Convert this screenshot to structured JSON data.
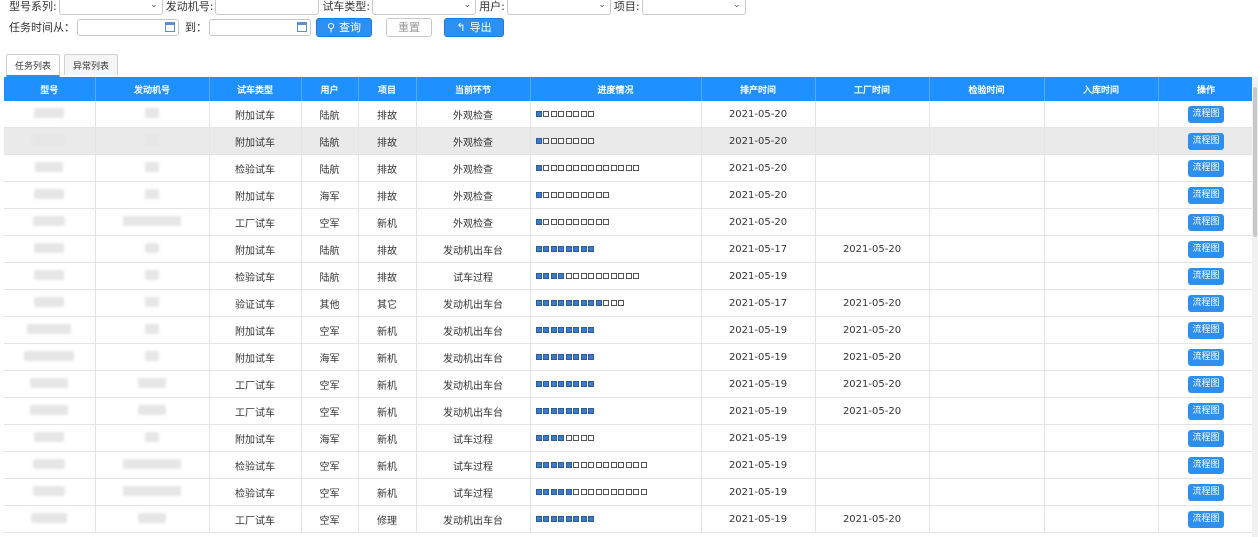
{
  "filters": {
    "model_series_label": "型号系列:",
    "engine_no_label": "发动机号:",
    "test_type_label": "试车类型:",
    "user_label": "用户:",
    "project_label": "项目:",
    "time_from_label": "任务时间从：",
    "time_to_label": "到：",
    "search_button": "查询",
    "reset_button": "重置",
    "export_button": "导出"
  },
  "tabs": [
    {
      "label": "任务列表",
      "active": true
    },
    {
      "label": "异常列表",
      "active": false
    }
  ],
  "table": {
    "columns": [
      "型号",
      "发动机号",
      "试车类型",
      "用户",
      "项目",
      "当前环节",
      "进度情况",
      "排产时间",
      "工厂时间",
      "检验时间",
      "入库时间",
      "操作"
    ],
    "action_label": "流程图",
    "rows": [
      {
        "type": "附加试车",
        "user": "陆航",
        "project": "排故",
        "stage": "外观检查",
        "progress_done": 1,
        "progress_total": 8,
        "sched": "2021-05-20",
        "factory": "",
        "inspect": "",
        "store": ""
      },
      {
        "type": "附加试车",
        "user": "陆航",
        "project": "排故",
        "stage": "外观检查",
        "progress_done": 1,
        "progress_total": 8,
        "sched": "2021-05-20",
        "factory": "",
        "inspect": "",
        "store": ""
      },
      {
        "type": "检验试车",
        "user": "陆航",
        "project": "排故",
        "stage": "外观检查",
        "progress_done": 1,
        "progress_total": 14,
        "sched": "2021-05-20",
        "factory": "",
        "inspect": "",
        "store": ""
      },
      {
        "type": "附加试车",
        "user": "海军",
        "project": "排故",
        "stage": "外观检查",
        "progress_done": 1,
        "progress_total": 10,
        "sched": "2021-05-20",
        "factory": "",
        "inspect": "",
        "store": ""
      },
      {
        "type": "工厂试车",
        "user": "空军",
        "project": "新机",
        "stage": "外观检查",
        "progress_done": 1,
        "progress_total": 10,
        "sched": "2021-05-20",
        "factory": "",
        "inspect": "",
        "store": ""
      },
      {
        "type": "附加试车",
        "user": "陆航",
        "project": "排故",
        "stage": "发动机出车台",
        "progress_done": 8,
        "progress_total": 8,
        "sched": "2021-05-17",
        "factory": "2021-05-20",
        "inspect": "",
        "store": ""
      },
      {
        "type": "检验试车",
        "user": "陆航",
        "project": "排故",
        "stage": "试车过程",
        "progress_done": 4,
        "progress_total": 14,
        "sched": "2021-05-19",
        "factory": "",
        "inspect": "",
        "store": ""
      },
      {
        "type": "验证试车",
        "user": "其他",
        "project": "其它",
        "stage": "发动机出车台",
        "progress_done": 9,
        "progress_total": 12,
        "sched": "2021-05-17",
        "factory": "2021-05-20",
        "inspect": "",
        "store": ""
      },
      {
        "type": "附加试车",
        "user": "空军",
        "project": "新机",
        "stage": "发动机出车台",
        "progress_done": 8,
        "progress_total": 8,
        "sched": "2021-05-19",
        "factory": "2021-05-20",
        "inspect": "",
        "store": ""
      },
      {
        "type": "附加试车",
        "user": "海军",
        "project": "新机",
        "stage": "发动机出车台",
        "progress_done": 8,
        "progress_total": 8,
        "sched": "2021-05-19",
        "factory": "2021-05-20",
        "inspect": "",
        "store": ""
      },
      {
        "type": "工厂试车",
        "user": "空军",
        "project": "新机",
        "stage": "发动机出车台",
        "progress_done": 8,
        "progress_total": 8,
        "sched": "2021-05-19",
        "factory": "2021-05-20",
        "inspect": "",
        "store": ""
      },
      {
        "type": "工厂试车",
        "user": "空军",
        "project": "新机",
        "stage": "发动机出车台",
        "progress_done": 8,
        "progress_total": 8,
        "sched": "2021-05-19",
        "factory": "2021-05-20",
        "inspect": "",
        "store": ""
      },
      {
        "type": "附加试车",
        "user": "海军",
        "project": "新机",
        "stage": "试车过程",
        "progress_done": 4,
        "progress_total": 8,
        "sched": "2021-05-19",
        "factory": "",
        "inspect": "",
        "store": ""
      },
      {
        "type": "检验试车",
        "user": "空军",
        "project": "新机",
        "stage": "试车过程",
        "progress_done": 5,
        "progress_total": 15,
        "sched": "2021-05-19",
        "factory": "",
        "inspect": "",
        "store": ""
      },
      {
        "type": "检验试车",
        "user": "空军",
        "project": "新机",
        "stage": "试车过程",
        "progress_done": 5,
        "progress_total": 15,
        "sched": "2021-05-19",
        "factory": "",
        "inspect": "",
        "store": ""
      },
      {
        "type": "工厂试车",
        "user": "空军",
        "project": "修理",
        "stage": "发动机出车台",
        "progress_done": 8,
        "progress_total": 8,
        "sched": "2021-05-19",
        "factory": "2021-05-20",
        "inspect": "",
        "store": ""
      }
    ]
  }
}
